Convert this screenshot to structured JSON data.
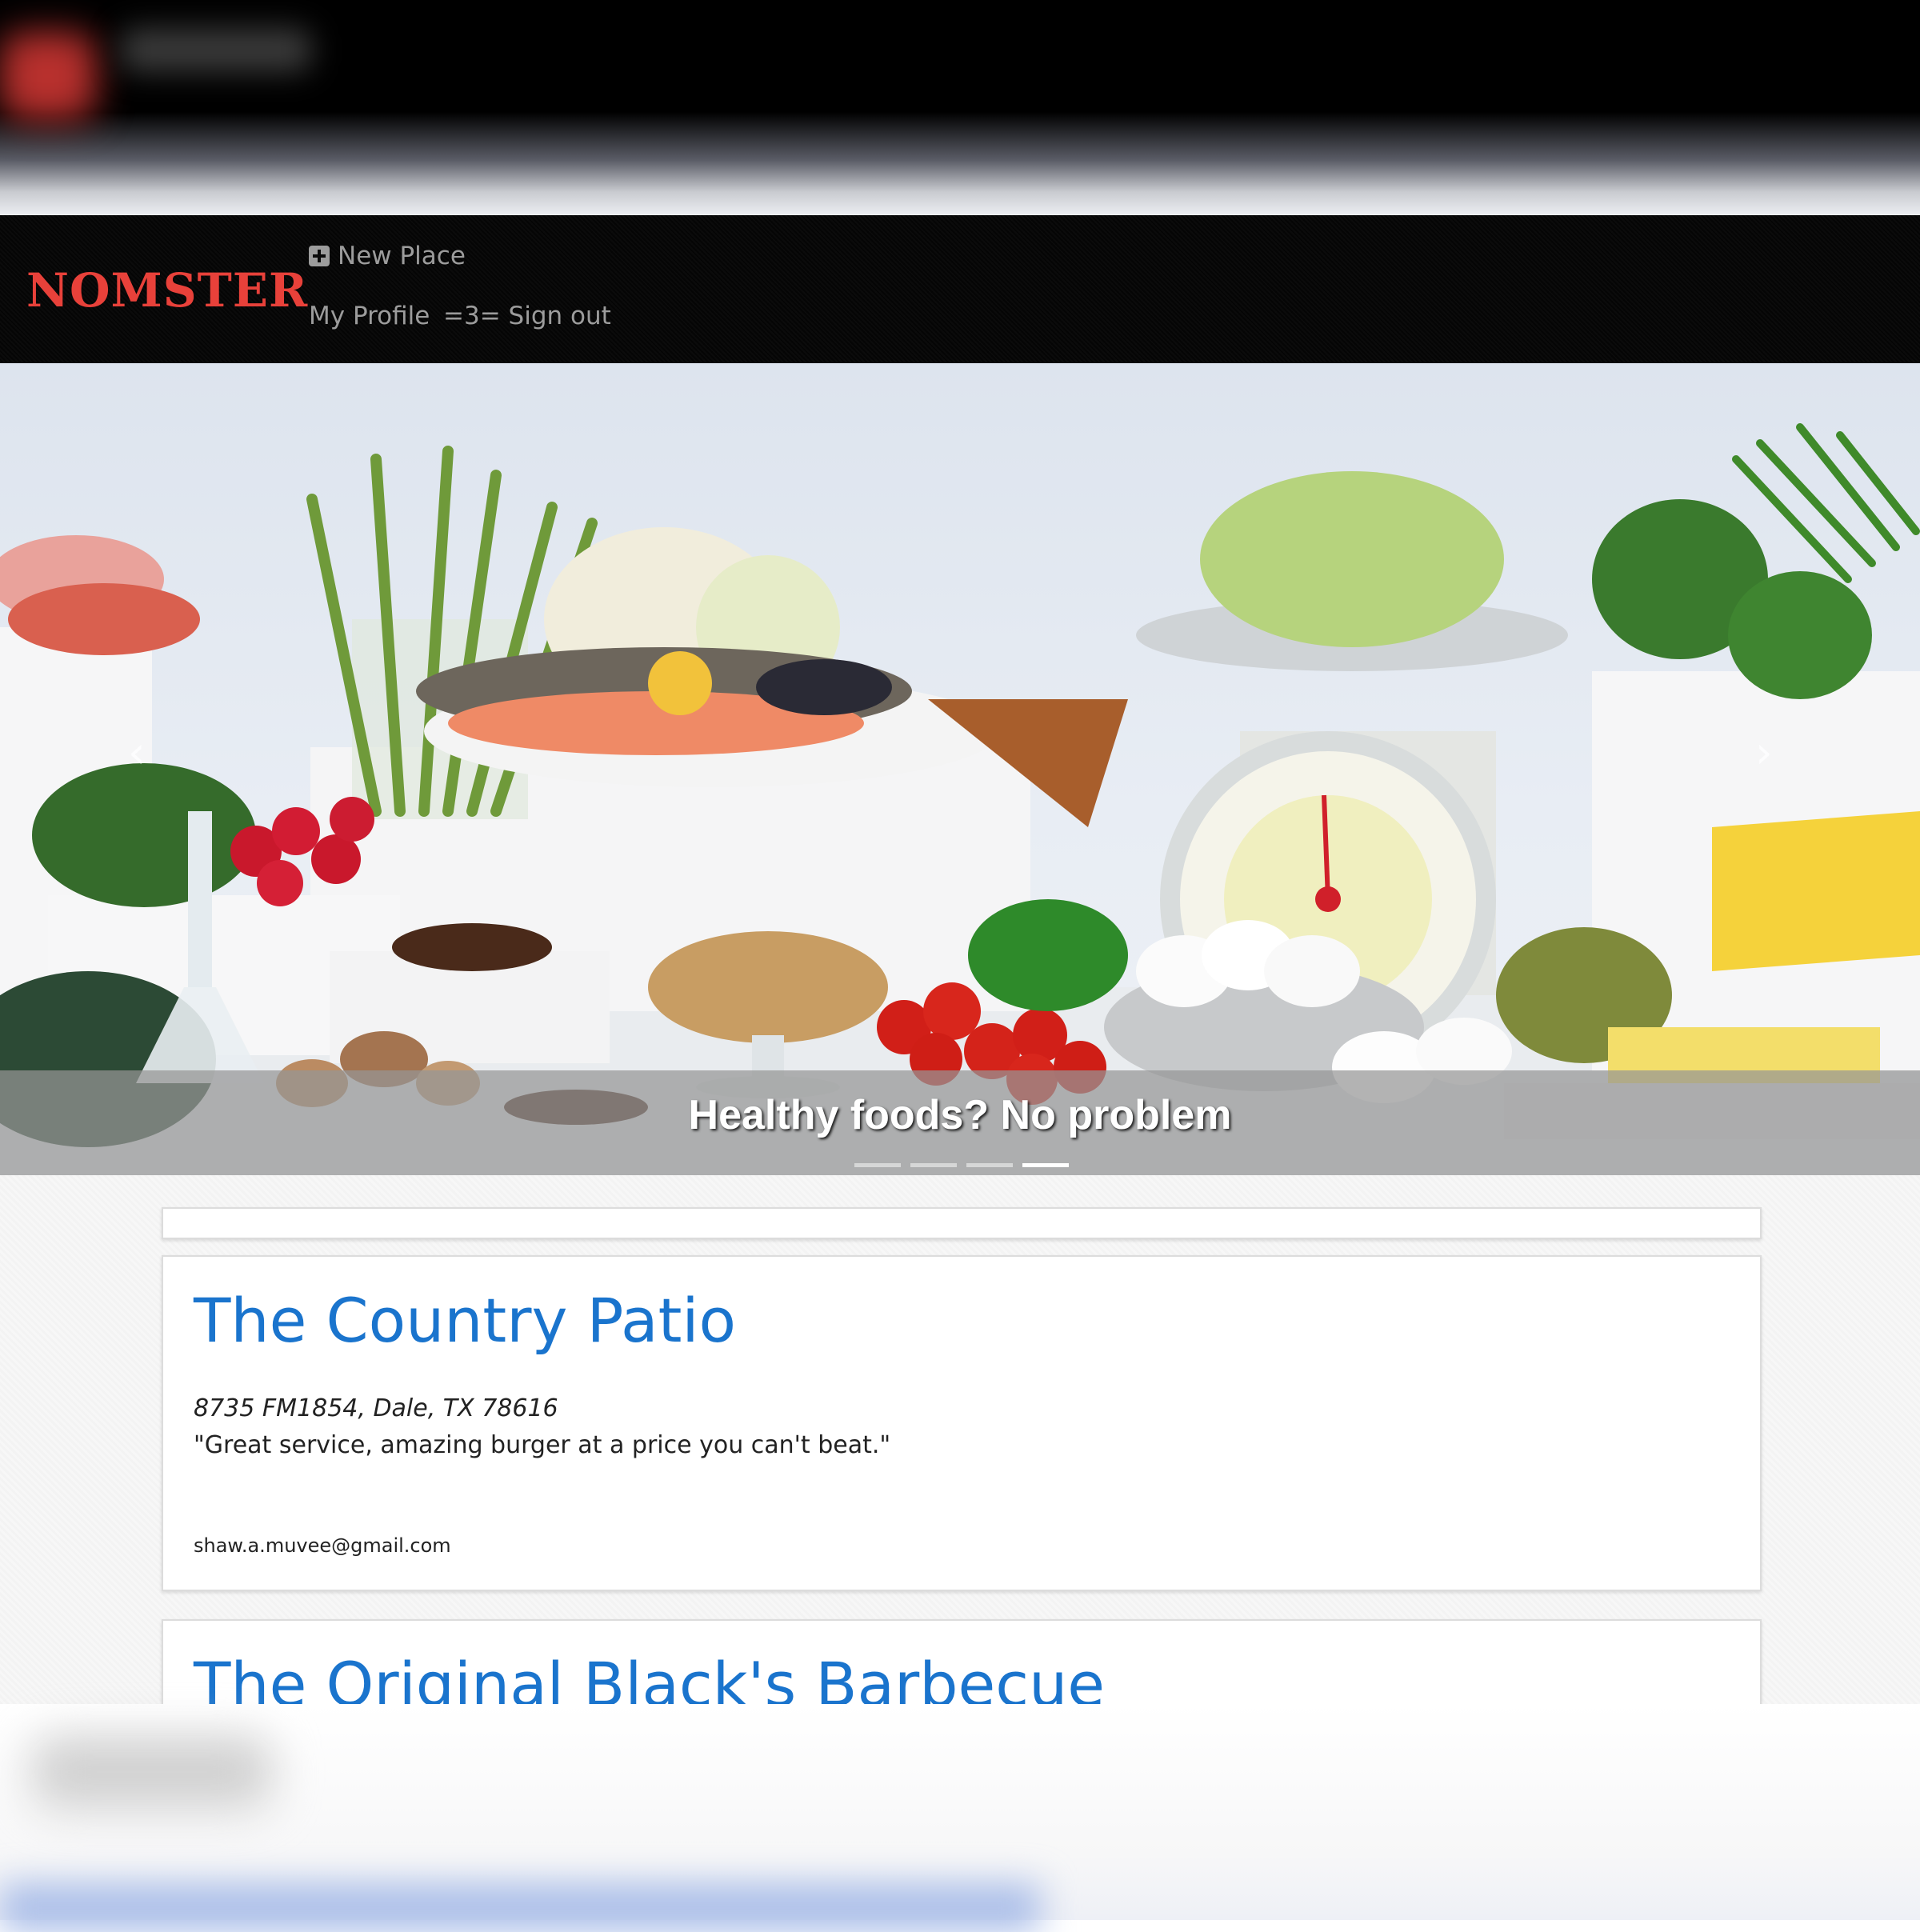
{
  "navbar": {
    "brand": "NOMSTER",
    "new_place_label": "New Place",
    "my_profile_label": "My Profile",
    "sign_out_label": "=3= Sign out",
    "brand_color": "#e8413a"
  },
  "carousel": {
    "caption": "Healthy foods? No problem",
    "slide_count": 4,
    "active_index": 3,
    "prev_icon": "chevron-left-icon",
    "next_icon": "chevron-right-icon"
  },
  "places": [
    {
      "name": "The Country Patio",
      "address": "8735 FM1854, Dale, TX 78616",
      "review": "\"Great service, amazing burger at a price you can't beat.\"",
      "email": "shaw.a.muvee@gmail.com"
    },
    {
      "name": "The Original Black's Barbecue"
    }
  ],
  "colors": {
    "link_blue": "#1a74cd",
    "nav_text": "#9c9c9c",
    "navbar_bg": "#0b0b0b"
  }
}
